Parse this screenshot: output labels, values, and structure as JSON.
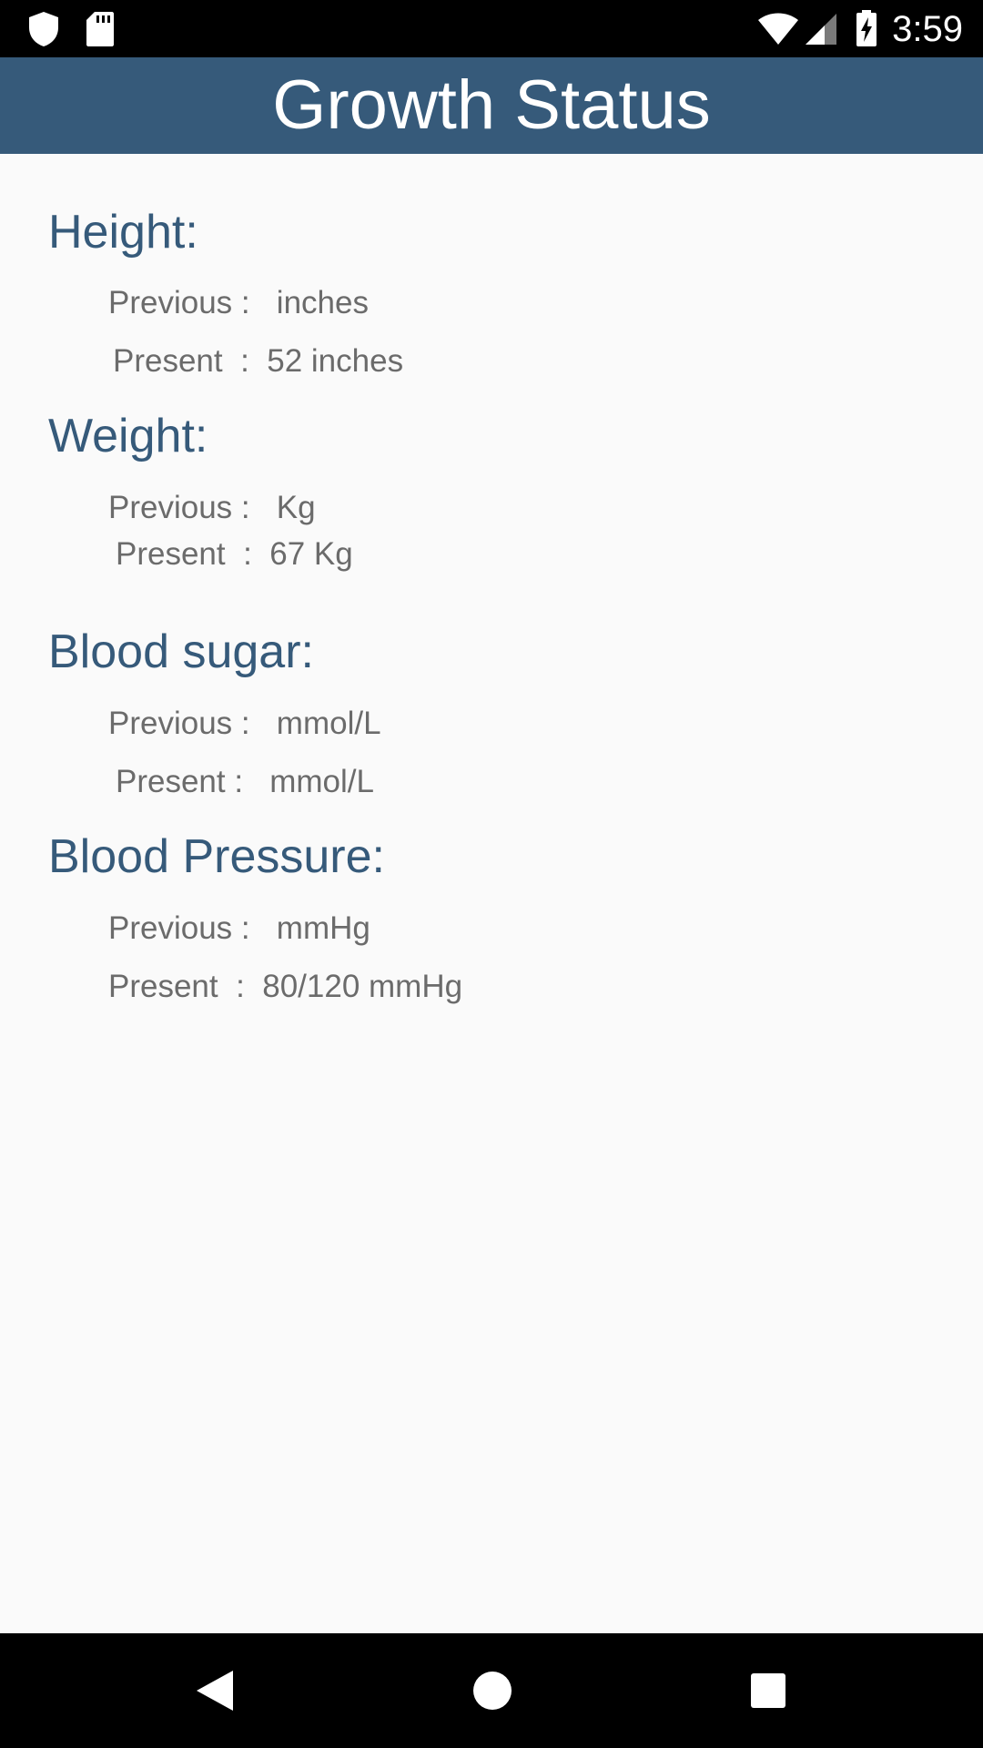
{
  "status_bar": {
    "time": "3:59",
    "left_icons": [
      "shield-icon",
      "sd-card-icon"
    ],
    "right_icons": [
      "wifi-icon",
      "signal-icon",
      "battery-charging-icon"
    ]
  },
  "app_bar": {
    "title": "Growth Status",
    "color": "#365a7a"
  },
  "sections": {
    "height": {
      "heading": "Height:",
      "previous": "Previous :   inches",
      "present": "Present  :  52 inches"
    },
    "weight": {
      "heading": "Weight:",
      "previous": "Previous :   Kg",
      "present": "Present  :  67 Kg"
    },
    "blood_sugar": {
      "heading": "Blood sugar:",
      "previous": "Previous :   mmol/L",
      "present": "Present :   mmol/L"
    },
    "blood_pressure": {
      "heading": "Blood Pressure:",
      "previous": "Previous :   mmHg",
      "present": "Present  :  80/120 mmHg"
    }
  },
  "nav_bar": {
    "buttons": [
      "back-icon",
      "home-icon",
      "recents-icon"
    ]
  }
}
